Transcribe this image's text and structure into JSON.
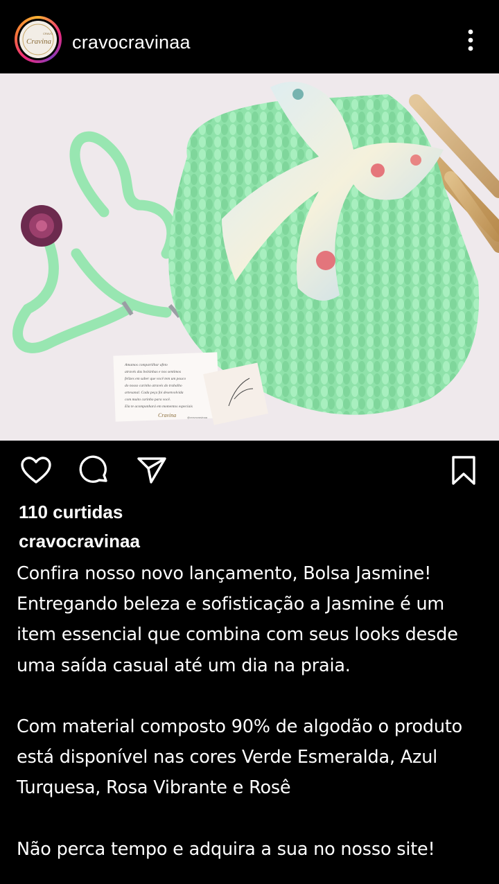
{
  "header": {
    "username": "cravocravinaa",
    "avatar_logo_small": "CRAVO",
    "avatar_logo_script": "Cravina",
    "more_icon": "more-vertical-icon"
  },
  "post": {
    "image_alt": "Bolsa Jasmine de crochê verde com lenço estampado",
    "card_text": "Amamos compartilhar afeto através das bolsinhas e nos sentimos felizes em saber que você tem um pouco do nosso carinho através do trabalho artesanal. Cada peça foi desenvolvida com muito carinho para você. Ela te acompanhará em momentos especiais e carregará um pouco da sua história.",
    "card_handle": "@cravocravinaa",
    "card_signature": "Cravina"
  },
  "actions": {
    "like_icon": "heart-icon",
    "comment_icon": "comment-icon",
    "share_icon": "send-icon",
    "save_icon": "bookmark-icon"
  },
  "likes": "110 curtidas",
  "author": "cravocravinaa",
  "caption": {
    "p1": "Confira nosso novo lançamento, Bolsa Jasmine! Entregando beleza e sofisticação a Jasmine é um item essencial que combina com seus looks desde uma saída casual até um dia na praia.",
    "p2": "Com material composto 90% de algodão o produto está disponível nas cores Verde Esmeralda, Azul Turquesa, Rosa Vibrante e Rosê",
    "p3": "Não perca tempo e adquira a sua no nosso site!"
  },
  "colors": {
    "background": "#000000",
    "text": "#ffffff",
    "bag_green": "#93e6ae",
    "photo_bg": "#efe9ec"
  }
}
